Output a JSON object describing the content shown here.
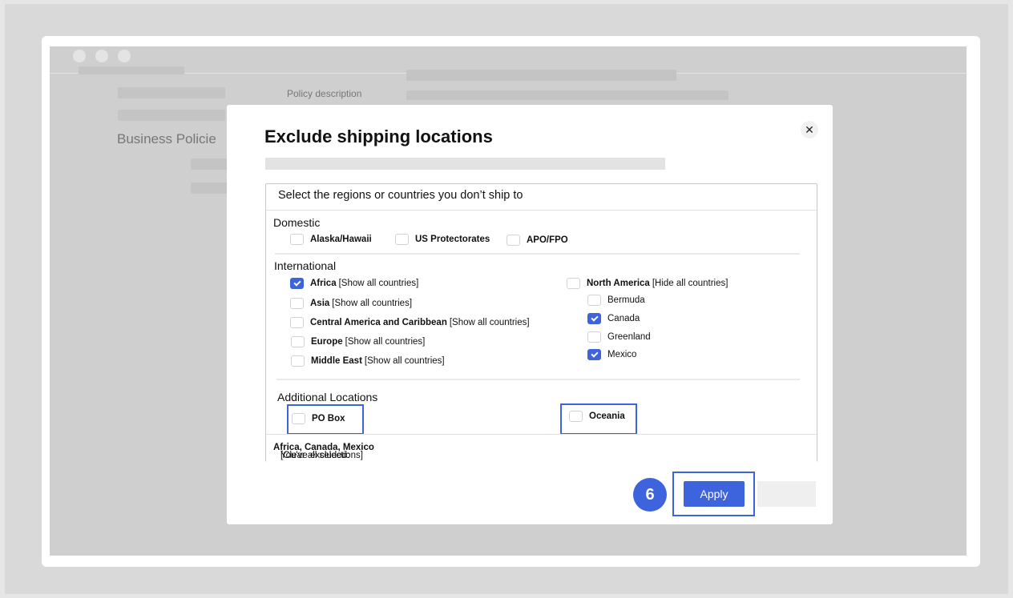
{
  "background": {
    "policy_description_label": "Policy description",
    "business_policies_heading": "Business Policie"
  },
  "modal": {
    "title": "Exclude shipping locations",
    "close_glyph": "✕",
    "instructions": "Select the regions or countries you don’t ship to",
    "domestic": {
      "label": "Domestic",
      "options": [
        {
          "label": "Alaska/Hawaii",
          "checked": false
        },
        {
          "label": "US Protectorates",
          "checked": false
        },
        {
          "label": "APO/FPO",
          "checked": false
        }
      ]
    },
    "international": {
      "label": "International",
      "regions": [
        {
          "label": "Africa",
          "toggle": "[Show all countries]",
          "checked": true
        },
        {
          "label": "Asia",
          "toggle": "[Show all countries]",
          "checked": false
        },
        {
          "label": "Central America and Caribbean",
          "toggle": "[Show all countries]",
          "checked": false
        },
        {
          "label": "Europe",
          "toggle": "[Show all countries]",
          "checked": false
        },
        {
          "label": "Middle East",
          "toggle": "[Show all countries]",
          "checked": false
        }
      ],
      "north_america": {
        "label": "North America",
        "toggle": "[Hide all countries]",
        "checked": false,
        "countries": [
          {
            "label": "Bermuda",
            "checked": false
          },
          {
            "label": "Canada",
            "checked": true
          },
          {
            "label": "Greenland",
            "checked": false
          },
          {
            "label": "Mexico",
            "checked": true
          }
        ]
      }
    },
    "additional": {
      "label": "Additional Locations",
      "options": [
        {
          "label": "PO Box",
          "checked": false
        },
        {
          "label": "Oceania",
          "checked": false
        }
      ]
    },
    "summary": {
      "prefix": "You've excluded: ",
      "items": "Africa, Canada, Mexico",
      "clear": " [Clear all selections]"
    },
    "apply_label": "Apply",
    "step_number": "6"
  },
  "colors": {
    "accent": "#3d63dd",
    "backdrop": "#cfcfcf"
  }
}
